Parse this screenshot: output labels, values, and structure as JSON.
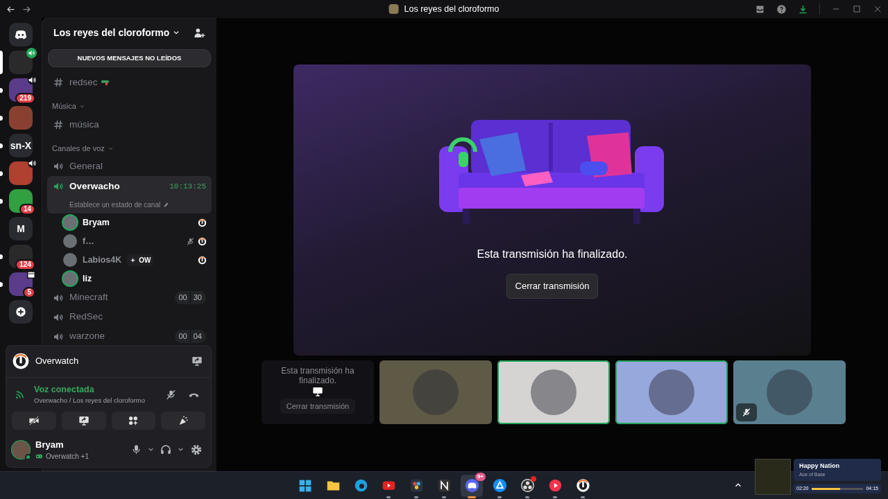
{
  "titlebar": {
    "title": "Los reyes del cloroformo"
  },
  "servers": [
    {
      "kind": "home",
      "selected": false,
      "unread": false
    },
    {
      "kind": "image",
      "selected": true,
      "speaking": true
    },
    {
      "kind": "image",
      "selected": false,
      "unread": true,
      "speaking": true,
      "badge": "219"
    },
    {
      "kind": "image",
      "selected": false,
      "unread": true
    },
    {
      "kind": "text",
      "label": "sn-X",
      "selected": false,
      "unread": true
    },
    {
      "kind": "image",
      "selected": false,
      "unread": true,
      "speaking": true
    },
    {
      "kind": "image",
      "selected": false,
      "unread": true,
      "badge": "14"
    },
    {
      "kind": "text",
      "label": "M",
      "selected": false,
      "unread": false
    },
    {
      "kind": "image",
      "selected": false,
      "unread": true,
      "badge": "124"
    },
    {
      "kind": "image",
      "selected": false,
      "unread": true,
      "badge": "5",
      "event": true
    },
    {
      "kind": "add",
      "selected": false,
      "unread": false
    }
  ],
  "sidebar": {
    "server_name": "Los reyes del cloroformo",
    "unread_banner": "NUEVOS MENSAJES NO LEÍDOS",
    "items": [
      {
        "kind": "text_channel",
        "name": "redsec",
        "emoji": true,
        "selected": false
      },
      {
        "kind": "category",
        "name": "Música",
        "channels": [
          {
            "kind": "text_channel",
            "name": "música",
            "selected": false
          }
        ]
      },
      {
        "kind": "category",
        "name": "Canales de voz",
        "channels": [
          {
            "kind": "voice_channel",
            "name": "General",
            "selected": false
          },
          {
            "kind": "voice_channel",
            "name": "Overwacho",
            "selected": true,
            "timer": "10:13:25",
            "status": "Establece un estado de canal",
            "members": [
              {
                "name": "Bryam",
                "speaking": true,
                "muted": false,
                "playing": true
              },
              {
                "name": "f…",
                "speaking": false,
                "muted": true,
                "playing": true
              },
              {
                "name": "Labios4K",
                "speaking": false,
                "muted": false,
                "playing": true,
                "tag": "OW"
              },
              {
                "name": "liz",
                "speaking": true,
                "muted": false,
                "playing": false
              }
            ]
          },
          {
            "kind": "voice_channel",
            "name": "Minecraft",
            "selected": false,
            "counts": [
              "00",
              "30"
            ]
          },
          {
            "kind": "voice_channel",
            "name": "RedSec",
            "selected": false
          },
          {
            "kind": "voice_channel",
            "name": "warzone",
            "selected": false,
            "counts": [
              "00",
              "04"
            ]
          }
        ]
      }
    ]
  },
  "panel": {
    "game": "Overwatch",
    "voice_status": "Voz conectada",
    "voice_location": "Overwacho / Los reyes del cloroformo",
    "actions": [
      {
        "kind": "camera"
      },
      {
        "kind": "screen"
      },
      {
        "kind": "activities"
      },
      {
        "kind": "soundboard"
      }
    ],
    "user": {
      "name": "Bryam",
      "activity": "Overwatch +1",
      "online": true
    }
  },
  "stream": {
    "message": "Esta transmisión ha finalizado.",
    "button": "Cerrar transmisión"
  },
  "tiles": [
    {
      "kind": "ended_stream",
      "message": "Esta transmisión ha finalizado.",
      "button": "Cerrar transmisión"
    },
    {
      "kind": "participant",
      "color": "#5e5a46",
      "speaking": false,
      "muted": false
    },
    {
      "kind": "participant",
      "color": "#d6d4d3",
      "speaking": true,
      "muted": false
    },
    {
      "kind": "participant",
      "color": "#97a8dd",
      "speaking": true,
      "muted": false
    },
    {
      "kind": "participant",
      "color": "#5a8090",
      "speaking": false,
      "muted": true
    }
  ],
  "taskbar": {
    "apps": [
      {
        "kind": "start",
        "running": false,
        "active": false,
        "alert": false
      },
      {
        "kind": "folder",
        "running": false,
        "active": false,
        "alert": false
      },
      {
        "kind": "browser",
        "running": false,
        "active": false,
        "alert": false
      },
      {
        "kind": "video",
        "running": true,
        "active": false,
        "alert": false
      },
      {
        "kind": "editor",
        "running": true,
        "active": false,
        "alert": false
      },
      {
        "kind": "letter",
        "running": true,
        "active": false,
        "alert": false
      },
      {
        "kind": "chat",
        "running": true,
        "active": true,
        "alert": false,
        "badge": "9+"
      },
      {
        "kind": "launcher",
        "running": true,
        "active": false,
        "alert": false
      },
      {
        "kind": "recorder",
        "running": true,
        "active": false,
        "alert": true
      },
      {
        "kind": "player",
        "running": true,
        "active": false,
        "alert": false
      },
      {
        "kind": "game",
        "running": true,
        "active": false,
        "alert": false
      }
    ]
  },
  "media": {
    "title": "Happy Nation",
    "artist": "Ace of Base",
    "elapsed": "02:20",
    "duration": "04:15",
    "level": 0.55
  }
}
